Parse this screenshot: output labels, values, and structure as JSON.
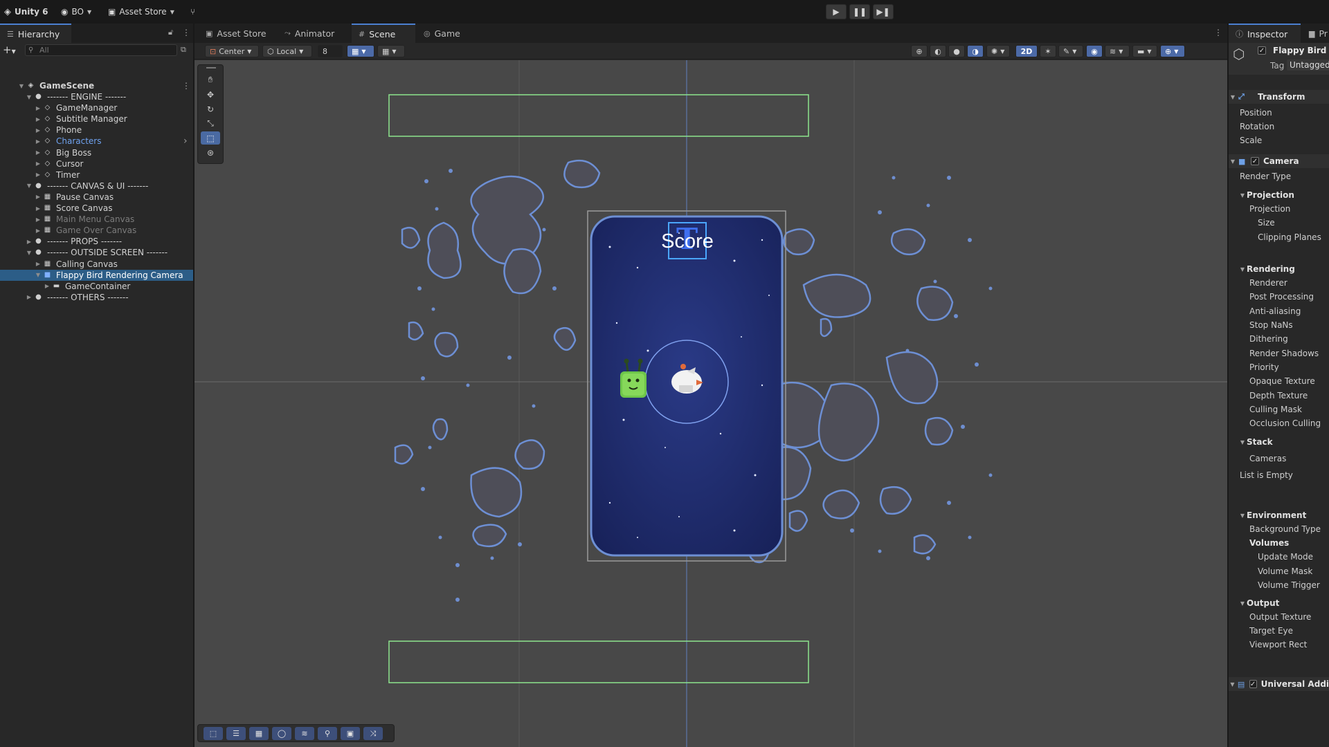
{
  "topbar": {
    "app": "Unity 6",
    "account": "BO",
    "asset_store": "Asset Store"
  },
  "hierarchy": {
    "tab": "Hierarchy",
    "search_placeholder": "All",
    "scene": "GameScene",
    "items": [
      {
        "label": "------- ENGINE -------",
        "kind": "separator",
        "depth": 1
      },
      {
        "label": "GameManager",
        "kind": "object",
        "depth": 2
      },
      {
        "label": "Subtitle Manager",
        "kind": "object",
        "depth": 2
      },
      {
        "label": "Phone",
        "kind": "object",
        "depth": 2
      },
      {
        "label": "Characters",
        "kind": "object",
        "depth": 2,
        "state": "link"
      },
      {
        "label": "Big Boss",
        "kind": "object",
        "depth": 2
      },
      {
        "label": "Cursor",
        "kind": "object",
        "depth": 2
      },
      {
        "label": "Timer",
        "kind": "object",
        "depth": 2
      },
      {
        "label": "------- CANVAS & UI -------",
        "kind": "separator",
        "depth": 1
      },
      {
        "label": "Pause Canvas",
        "kind": "canvas",
        "depth": 2
      },
      {
        "label": "Score Canvas",
        "kind": "canvas",
        "depth": 2
      },
      {
        "label": "Main Menu Canvas",
        "kind": "canvas",
        "depth": 2,
        "state": "dim"
      },
      {
        "label": "Game Over Canvas",
        "kind": "canvas",
        "depth": 2,
        "state": "dim"
      },
      {
        "label": "------- PROPS -------",
        "kind": "separator",
        "depth": 1
      },
      {
        "label": "------- OUTSIDE SCREEN -------",
        "kind": "separator",
        "depth": 1
      },
      {
        "label": "Calling Canvas",
        "kind": "canvas",
        "depth": 2
      },
      {
        "label": "Flappy Bird Rendering Camera",
        "kind": "camera",
        "depth": 2,
        "state": "selected"
      },
      {
        "label": "GameContainer",
        "kind": "folder",
        "depth": 3
      },
      {
        "label": "------- OTHERS -------",
        "kind": "separator",
        "depth": 1
      }
    ]
  },
  "tabs": [
    {
      "label": "Asset Store",
      "icon": "bag-icon"
    },
    {
      "label": "Animator",
      "icon": "animator-icon"
    },
    {
      "label": "Scene",
      "icon": "grid-icon",
      "active": true
    },
    {
      "label": "Game",
      "icon": "gamepad-icon"
    }
  ],
  "scene_toolbar": {
    "pivot": "Center",
    "space": "Local",
    "snap_value": "8",
    "mode_2d": "2D"
  },
  "viewport": {
    "score_text": "Score",
    "text_gizmo": "T"
  },
  "inspector": {
    "tab": "Inspector",
    "tab2": "Pr",
    "object_name": "Flappy Bird R",
    "tag_label": "Tag",
    "tag_value": "Untagged",
    "rows": [
      {
        "label": "Transform",
        "kind": "component"
      },
      {
        "label": "Position",
        "kind": "field"
      },
      {
        "label": "Rotation",
        "kind": "field"
      },
      {
        "label": "Scale",
        "kind": "field"
      },
      {
        "label": "Camera",
        "kind": "component"
      },
      {
        "label": "Render Type",
        "kind": "field"
      },
      {
        "label": "Projection",
        "kind": "section"
      },
      {
        "label": "Projection",
        "kind": "subfield"
      },
      {
        "label": "Size",
        "kind": "subfield2"
      },
      {
        "label": "Clipping Planes",
        "kind": "subfield2"
      },
      {
        "label": "Rendering",
        "kind": "section"
      },
      {
        "label": "Renderer",
        "kind": "subfield"
      },
      {
        "label": "Post Processing",
        "kind": "subfield"
      },
      {
        "label": "Anti-aliasing",
        "kind": "subfield"
      },
      {
        "label": "Stop NaNs",
        "kind": "subfield"
      },
      {
        "label": "Dithering",
        "kind": "subfield"
      },
      {
        "label": "Render Shadows",
        "kind": "subfield"
      },
      {
        "label": "Priority",
        "kind": "subfield"
      },
      {
        "label": "Opaque Texture",
        "kind": "subfield"
      },
      {
        "label": "Depth Texture",
        "kind": "subfield"
      },
      {
        "label": "Culling Mask",
        "kind": "subfield"
      },
      {
        "label": "Occlusion Culling",
        "kind": "subfield"
      },
      {
        "label": "Stack",
        "kind": "section"
      },
      {
        "label": "Cameras",
        "kind": "subfield"
      },
      {
        "label": "List is Empty",
        "kind": "field"
      },
      {
        "label": "Environment",
        "kind": "section"
      },
      {
        "label": "Background Type",
        "kind": "subfield"
      },
      {
        "label": "Volumes",
        "kind": "subbold"
      },
      {
        "label": "Update Mode",
        "kind": "subfield2"
      },
      {
        "label": "Volume Mask",
        "kind": "subfield2"
      },
      {
        "label": "Volume Trigger",
        "kind": "subfield2"
      },
      {
        "label": "Output",
        "kind": "section"
      },
      {
        "label": "Output Texture",
        "kind": "subfield"
      },
      {
        "label": "Target Eye",
        "kind": "subfield"
      },
      {
        "label": "Viewport Rect",
        "kind": "subfield"
      },
      {
        "label": "Universal Addi",
        "kind": "component"
      }
    ]
  },
  "colors": {
    "accent": "#4b7fd0",
    "selection": "#2c5d87",
    "phone_screen": "#1e2d6b",
    "bounds_green": "#7fe07f",
    "outline_blue": "#5b7fc2"
  }
}
